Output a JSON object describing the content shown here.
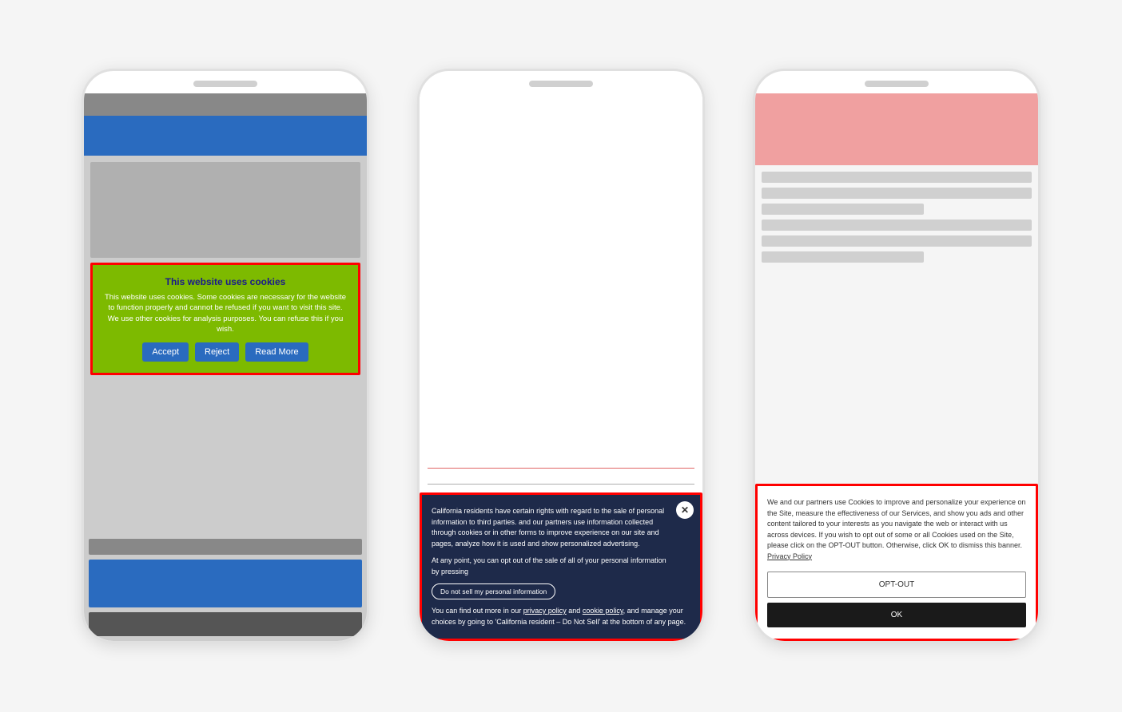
{
  "phone1": {
    "notch": "",
    "cookie_banner": {
      "title": "This website uses cookies",
      "body": "This website uses cookies. Some cookies are necessary for the website to function properly and cannot be refused if you want to visit this site. We use other cookies for analysis purposes. You can refuse this if you wish.",
      "accept_label": "Accept",
      "reject_label": "Reject",
      "read_more_label": "Read More"
    }
  },
  "phone2": {
    "cookie_banner": {
      "close_icon": "✕",
      "paragraph1": "California residents have certain rights with regard to the sale of personal information to third parties.                        and our partners use information collected through cookies or in other forms to improve experience on our site and pages, analyze how it is used and show personalized advertising.",
      "paragraph2": "At any point, you can opt out of the sale of all of your personal information by pressing",
      "opt_out_pill": "Do not sell my personal information",
      "paragraph3": "You can find out more in our privacy policy and cookie policy, and manage your choices by going to 'California resident – Do Not Sell' at the bottom of any page."
    }
  },
  "phone3": {
    "cookie_banner": {
      "body": "We and our partners use Cookies to improve and personalize your experience on the Site, measure the effectiveness of our Services, and show you ads and other content tailored to your interests as you navigate the web or interact with us across devices. If you wish to opt out of some or all Cookies used on the Site, please click on the OPT-OUT button. Otherwise, click OK to dismiss this banner.",
      "privacy_link": "Privacy Policy",
      "opt_out_label": "OPT-OUT",
      "ok_label": "OK"
    }
  }
}
